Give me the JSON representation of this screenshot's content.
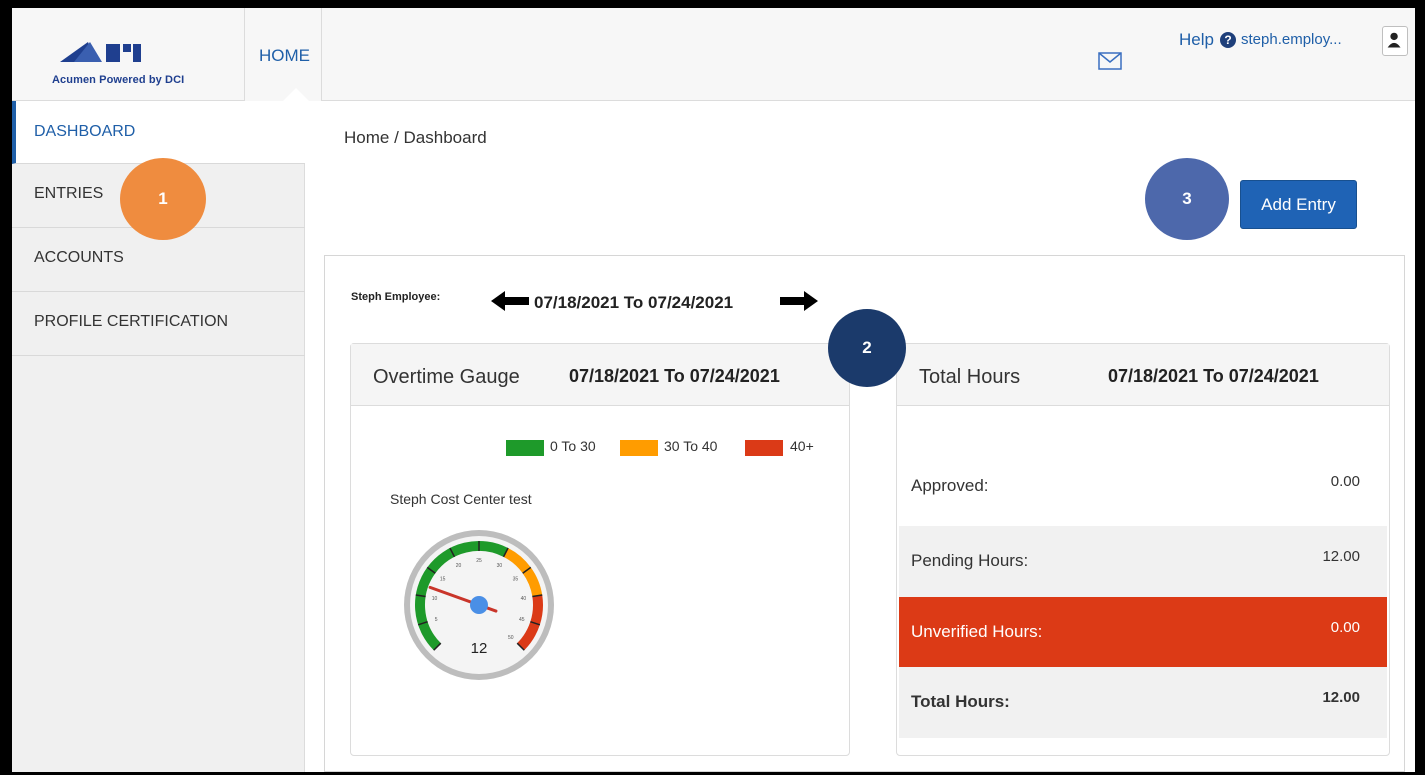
{
  "header": {
    "logo_tagline": "Acumen Powered by DCI",
    "nav_home": "HOME",
    "help": "Help",
    "help_icon": "?",
    "user": "steph.employ..."
  },
  "sidebar": {
    "items": [
      {
        "label": "DASHBOARD",
        "active": true
      },
      {
        "label": "ENTRIES"
      },
      {
        "label": "ACCOUNTS"
      },
      {
        "label": "PROFILE CERTIFICATION"
      }
    ]
  },
  "annotations": [
    "1",
    "2",
    "3"
  ],
  "breadcrumb": "Home / Dashboard",
  "add_entry": "Add Entry",
  "dashboard": {
    "employee": "Steph Employee:",
    "week_range": "07/18/2021 To 07/24/2021"
  },
  "overtime_gauge": {
    "title": "Overtime Gauge",
    "range": "07/18/2021 To 07/24/2021",
    "legend": [
      {
        "label": "0 To 30",
        "color": "#1e9a2a"
      },
      {
        "label": "30 To 40",
        "color": "#ff9c00"
      },
      {
        "label": "40+",
        "color": "#db3a17"
      }
    ],
    "series_name": "Steph Cost Center test",
    "value": 12,
    "value_label": "12",
    "min": 0,
    "max": 50,
    "tick_labels": [
      "5",
      "10",
      "15",
      "20",
      "25",
      "30",
      "35",
      "40",
      "45",
      "50"
    ]
  },
  "total_hours": {
    "title": "Total Hours",
    "range": "07/18/2021 To 07/24/2021",
    "rows": [
      {
        "label": "Approved:",
        "value": "0.00"
      },
      {
        "label": "Pending Hours:",
        "value": "12.00"
      },
      {
        "label": "Unverified Hours:",
        "value": "0.00"
      },
      {
        "label": "Total Hours:",
        "value": "12.00"
      }
    ]
  },
  "colors": {
    "accent": "#1f5fa8",
    "button": "#1f63b5",
    "badge_orange": "#ef8c3f",
    "badge_navy": "#1b3a6b",
    "badge_blue": "#4d68ab",
    "unverified_row": "#dc3a16"
  },
  "icons": [
    "mail-icon",
    "help-icon",
    "user-icon",
    "arrow-left-icon",
    "arrow-right-icon"
  ]
}
